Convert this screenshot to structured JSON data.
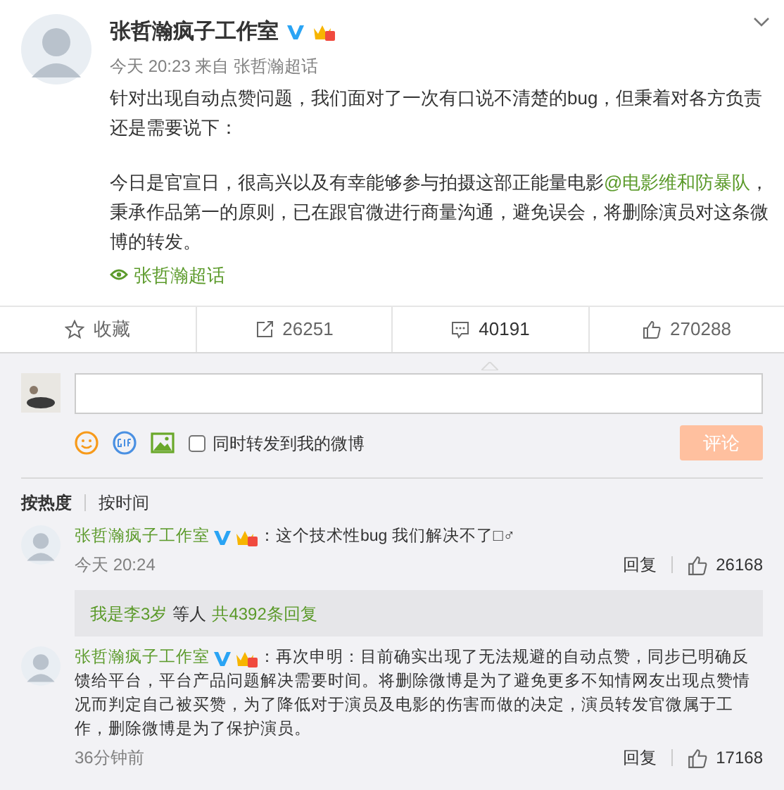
{
  "post": {
    "author": "张哲瀚疯子工作室",
    "meta": "今天 20:23 来自 张哲瀚超话",
    "paragraphs": [
      [
        {
          "kind": "text",
          "text": "针对出现自动点赞问题，我们面对了一次有口说不清楚的bug，但秉着对各方负责还是需要说下："
        }
      ],
      [
        {
          "kind": "text",
          "text": "今日是官宣日，很高兴以及有幸能够参与拍摄这部正能量电影"
        },
        {
          "kind": "mention",
          "text": "@电影维和防暴队"
        },
        {
          "kind": "text",
          "text": "，秉承作品第一的原则，已在跟官微进行商量沟通，避免误会，将删除演员对这条微博的转发。"
        }
      ]
    ],
    "topic": "张哲瀚超话"
  },
  "actions": [
    {
      "kind": "favorite",
      "label": "收藏",
      "selected": false
    },
    {
      "kind": "repost",
      "label": "26251",
      "selected": false
    },
    {
      "kind": "comment",
      "label": "40191",
      "selected": true
    },
    {
      "kind": "like",
      "label": "270288",
      "selected": false
    }
  ],
  "composer": {
    "repost_option": {
      "label": "同时转发到我的微博",
      "checked": false
    },
    "submit": {
      "label": "评论",
      "disabled": true
    }
  },
  "sort_tabs": [
    {
      "label": "按热度",
      "selected": true
    },
    {
      "label": "按时间",
      "selected": false
    }
  ],
  "comments": [
    {
      "author": "张哲瀚疯子工作室",
      "text": "：这个技术性bug 我们解决不了□♂",
      "time": "今天 20:24",
      "reply": "回复",
      "likes": "26168",
      "replies": {
        "users": "我是李3岁",
        "middle": "等人",
        "total": "共4392条回复"
      }
    },
    {
      "author": "张哲瀚疯子工作室",
      "text": "：再次申明：目前确实出现了无法规避的自动点赞，同步已明确反馈给平台，平台产品问题解决需要时间。将删除微博是为了避免更多不知情网友出现点赞情况而判定自己被买赞，为了降低对于演员及电影的伤害而做的决定，演员转发官微属于工作，删除微博是为了保护演员。",
      "time": "36分钟前",
      "reply": "回复",
      "likes": "17168"
    }
  ]
}
